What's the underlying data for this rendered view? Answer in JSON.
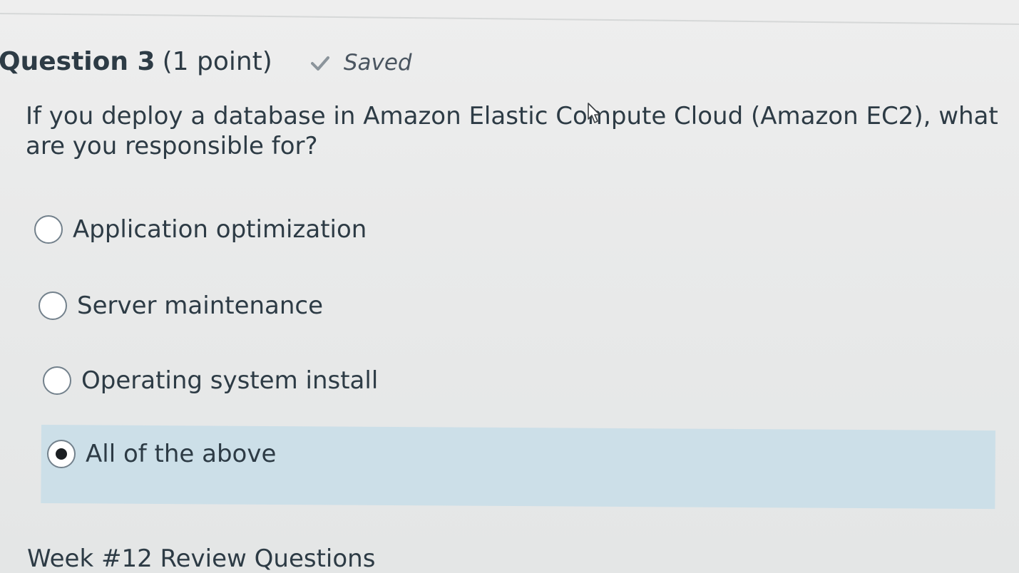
{
  "question": {
    "title": "Question 3",
    "points": "(1 point)",
    "saved_label": "Saved",
    "text": "If you deploy a database in Amazon Elastic Compute Cloud (Amazon EC2), what are you responsible for?"
  },
  "options": [
    {
      "label": "Application optimization",
      "selected": false
    },
    {
      "label": "Server maintenance",
      "selected": false
    },
    {
      "label": "Operating system install",
      "selected": false
    },
    {
      "label": "All of the above",
      "selected": true
    }
  ],
  "footer": {
    "title": "Week #12 Review Questions"
  },
  "colors": {
    "selected_background": "#ccdfe8",
    "text": "#2d3b45"
  },
  "icons": {
    "saved": "check-icon",
    "cursor": "mouse-pointer-icon"
  }
}
